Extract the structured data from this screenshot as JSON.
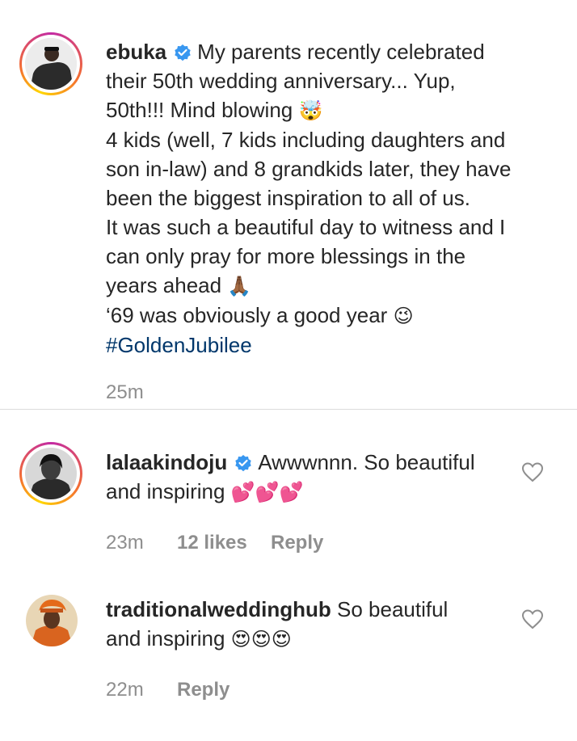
{
  "caption": {
    "username": "ebuka",
    "text_1": "My parents recently celebrated",
    "text_2": "their 50th wedding anniversary... Yup,",
    "text_3": "50th!!! Mind blowing",
    "emoji_3": "🤯",
    "text_4": "4 kids (well, 7 kids including daughters and",
    "text_5": "son in-law) and 8 grandkids later, they have",
    "text_6": "been the biggest inspiration to all of us.",
    "text_7": "It was such a beautiful day to witness and I",
    "text_8": "can only pray for more blessings in the",
    "text_9": "years ahead",
    "emoji_9": "🙏🏾",
    "text_10": "‘69 was obviously a good year",
    "emoji_10": "😉",
    "hashtag": "#GoldenJubilee",
    "time": "25m"
  },
  "comments": [
    {
      "username": "lalaakindoju",
      "text_1": "Awwwnnn. So beautiful",
      "text_2": "and inspiring",
      "emojis": "💕💕💕",
      "time": "23m",
      "likes": "12 likes",
      "reply": "Reply"
    },
    {
      "username": "traditionalweddinghub",
      "text_1": "So beautiful",
      "text_2": "and inspiring",
      "emojis": "😍😍😍",
      "time": "22m",
      "reply": "Reply"
    }
  ],
  "colors": {
    "text": "#262626",
    "muted": "#8e8e8e",
    "hashtag": "#00376b",
    "verified": "#3897f0",
    "divider": "#dbdbdb"
  }
}
